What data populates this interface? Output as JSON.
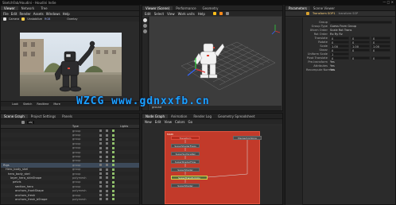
{
  "window": {
    "title": "SketchFab/Houdini - Houdini Indie"
  },
  "main_menu": [
    "File",
    "Edit",
    "Render",
    "Assets",
    "Windows",
    "Help",
    "Build",
    "Modeling",
    "Character"
  ],
  "left_viewer": {
    "tabs": [
      "Viewer",
      "Network",
      "Tree"
    ],
    "toolbar": [
      "Camera",
      "Unstabilize",
      "RGB",
      "Overlay"
    ],
    "bottom_bar": [
      "Look",
      "Sketch",
      "Realtime",
      "More"
    ]
  },
  "scene_viewer": {
    "tabs": [
      "Viewer (Scene)",
      "Performance",
      "Geometry"
    ],
    "menu": [
      "Edit",
      "Select",
      "View",
      "Work units",
      "Help"
    ],
    "label": "ground"
  },
  "params": {
    "tabs": [
      "Parameters",
      "Scene Viewer"
    ],
    "node_name": "Transform SOP1",
    "header_value": "transform SOP",
    "rows": [
      {
        "label": "Group",
        "value": ""
      },
      {
        "label": "Group Type",
        "value": "Guess From Group"
      },
      {
        "label": "Xform Order",
        "value": "Scale Rot Trans"
      },
      {
        "label": "Rot Order",
        "value": "Rx Ry Rz"
      },
      {
        "label": "Translate",
        "values": [
          "0",
          "0",
          "0"
        ]
      },
      {
        "label": "Rotate",
        "values": [
          "0",
          "0",
          "0"
        ]
      },
      {
        "label": "Scale",
        "values": [
          "1.00",
          "1.00",
          "1.00"
        ]
      },
      {
        "label": "Shear",
        "values": [
          "0",
          "0",
          "0"
        ]
      },
      {
        "label": "Uniform Scale",
        "value": "1"
      },
      {
        "label": "Pivot Translate",
        "values": [
          "0",
          "0",
          "0"
        ]
      },
      {
        "label": "Pre-transform",
        "value": "Yes"
      },
      {
        "label": "Attributes",
        "value": "Yes"
      },
      {
        "label": "Recompute Normals",
        "value": "Yes"
      }
    ]
  },
  "outliner": {
    "tabs": [
      "Scene Graph",
      "Project Settings",
      "Panels"
    ],
    "path": "obj",
    "columns": [
      "",
      "Type",
      "",
      "",
      "Lights"
    ],
    "rows": [
      {
        "name": "",
        "type": "group"
      },
      {
        "name": "",
        "type": "group"
      },
      {
        "name": "",
        "type": "group"
      },
      {
        "name": "",
        "type": "group"
      },
      {
        "name": "",
        "type": "group"
      },
      {
        "name": "",
        "type": "group"
      },
      {
        "name": "",
        "type": "group"
      },
      {
        "name": "",
        "type": "group"
      },
      {
        "name": "Rigs",
        "type": "group"
      },
      {
        "name": "Hero_body_skel",
        "type": "group"
      },
      {
        "name": "hero_body_skel",
        "type": "group"
      },
      {
        "name": "layer_hero_skinShape",
        "type": "polymesh"
      },
      {
        "name": "pelvis",
        "type": "group"
      },
      {
        "name": "section_hero",
        "type": "group"
      },
      {
        "name": "anchors_frontShape",
        "type": "polymesh"
      },
      {
        "name": "anchors_fresh",
        "type": "group"
      },
      {
        "name": "anchors_fresh_bShape",
        "type": "polymesh"
      }
    ]
  },
  "network": {
    "tabs": [
      "Node Graph",
      "Animation",
      "Render Log",
      "Geometry Spreadsheet"
    ],
    "menu": [
      "New",
      "Edit",
      "View",
      "Colors",
      "Go"
    ],
    "path": "MAIN",
    "nodes": [
      {
        "id": "n1",
        "label": "Transform",
        "style": "red"
      },
      {
        "id": "n2",
        "label": "Merge/Combine",
        "style": "normal"
      },
      {
        "id": "n3",
        "label": "SuperShaderFlags",
        "style": "normal"
      },
      {
        "id": "n4",
        "label": "SuperSurfaceRel",
        "style": "normal"
      },
      {
        "id": "n5",
        "label": "SuperShaderFlow",
        "style": "normal"
      },
      {
        "id": "n6",
        "label": "SuperShader",
        "style": "normal"
      },
      {
        "id": "n7",
        "label": "SuperTransformUv",
        "style": "selected"
      },
      {
        "id": "n8",
        "label": "SuperShader",
        "style": "normal"
      }
    ]
  },
  "watermark": "WZCG www.gdnxxfb.cn"
}
